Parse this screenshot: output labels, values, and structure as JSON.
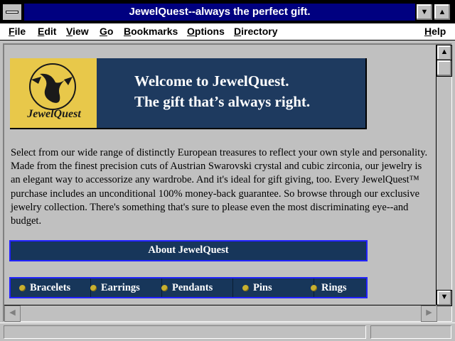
{
  "window": {
    "title": "JewelQuest--always the perfect gift."
  },
  "menu": [
    {
      "label": "File",
      "u": "F",
      "rest": "ile"
    },
    {
      "label": "Edit",
      "u": "E",
      "rest": "dit"
    },
    {
      "label": "View",
      "u": "V",
      "rest": "iew"
    },
    {
      "label": "Go",
      "u": "G",
      "rest": "o"
    },
    {
      "label": "Bookmarks",
      "u": "B",
      "rest": "ookmarks"
    },
    {
      "label": "Options",
      "u": "O",
      "rest": "ptions"
    },
    {
      "label": "Directory",
      "u": "D",
      "rest": "irectory"
    },
    {
      "label": "Help",
      "u": "H",
      "rest": "elp"
    }
  ],
  "banner": {
    "logo_text": "JewelQuest",
    "line1": "Welcome to JewelQuest.",
    "line2": "The gift that’s always right."
  },
  "description": "Select from our wide range of distinctly European treasures to reflect your own style and personality. Made from the finest precision cuts of Austrian Swarovski crystal and cubic zirconia, our jewelry is an elegant way to accessorize any wardrobe. And it's ideal for gift giving, too. Every JewelQuest™ purchase includes an unconditional 100% money-back guarantee. So browse through our exclusive jewelry collection. There's something that's sure to please even the most discriminating eye--and budget.",
  "about_label": "About JewelQuest",
  "nav": {
    "bracelets": "Bracelets",
    "earrings": "Earrings",
    "pendants": "Pendants",
    "pins": "Pins",
    "rings": "Rings"
  },
  "icons": {
    "system_menu": "system-menu-icon",
    "minimize": "minimize-arrow-icon",
    "maximize": "maximize-arrow-icon",
    "scroll_up": "scroll-up-arrow-icon",
    "scroll_down": "scroll-down-arrow-icon",
    "scroll_left": "scroll-left-arrow-icon",
    "scroll_right": "scroll-right-arrow-icon"
  },
  "colors": {
    "titlebar": "#000080",
    "banner_bg": "#1e3a5f",
    "logo_bg": "#e8c84a",
    "nav_border": "#2222ff"
  }
}
